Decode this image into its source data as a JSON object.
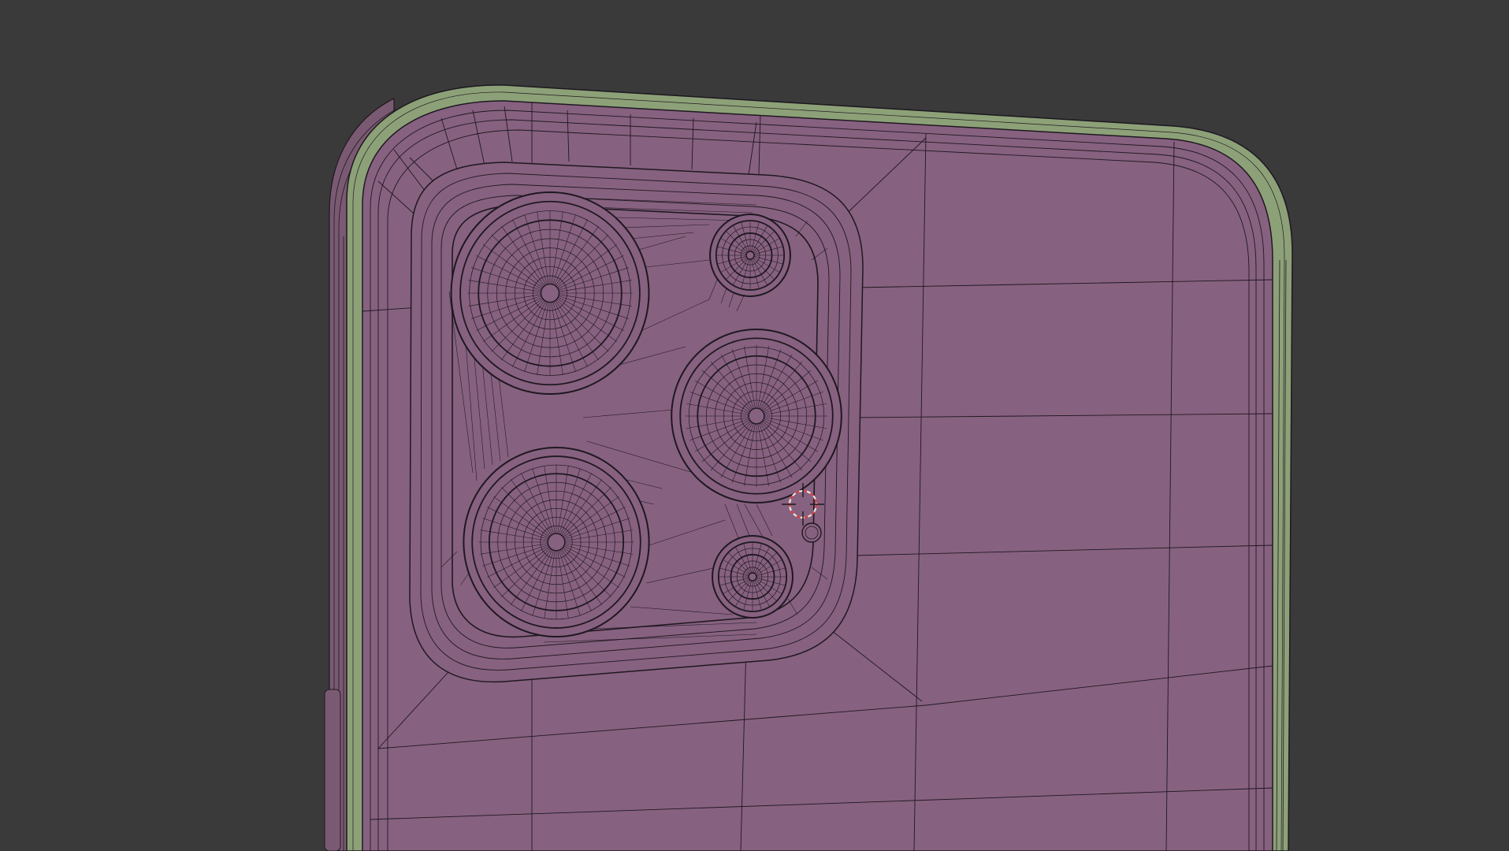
{
  "viewport": {
    "background_color": "#3a3a3a",
    "shading": "wireframe-on-solid"
  },
  "model": {
    "body_color": "#876180",
    "frame_color": "#8da178",
    "wire_color": "#1e1820"
  },
  "cursor": {
    "icon": "3d-cursor-icon",
    "colors": [
      "#e8e8e8",
      "#d73a3a"
    ]
  }
}
